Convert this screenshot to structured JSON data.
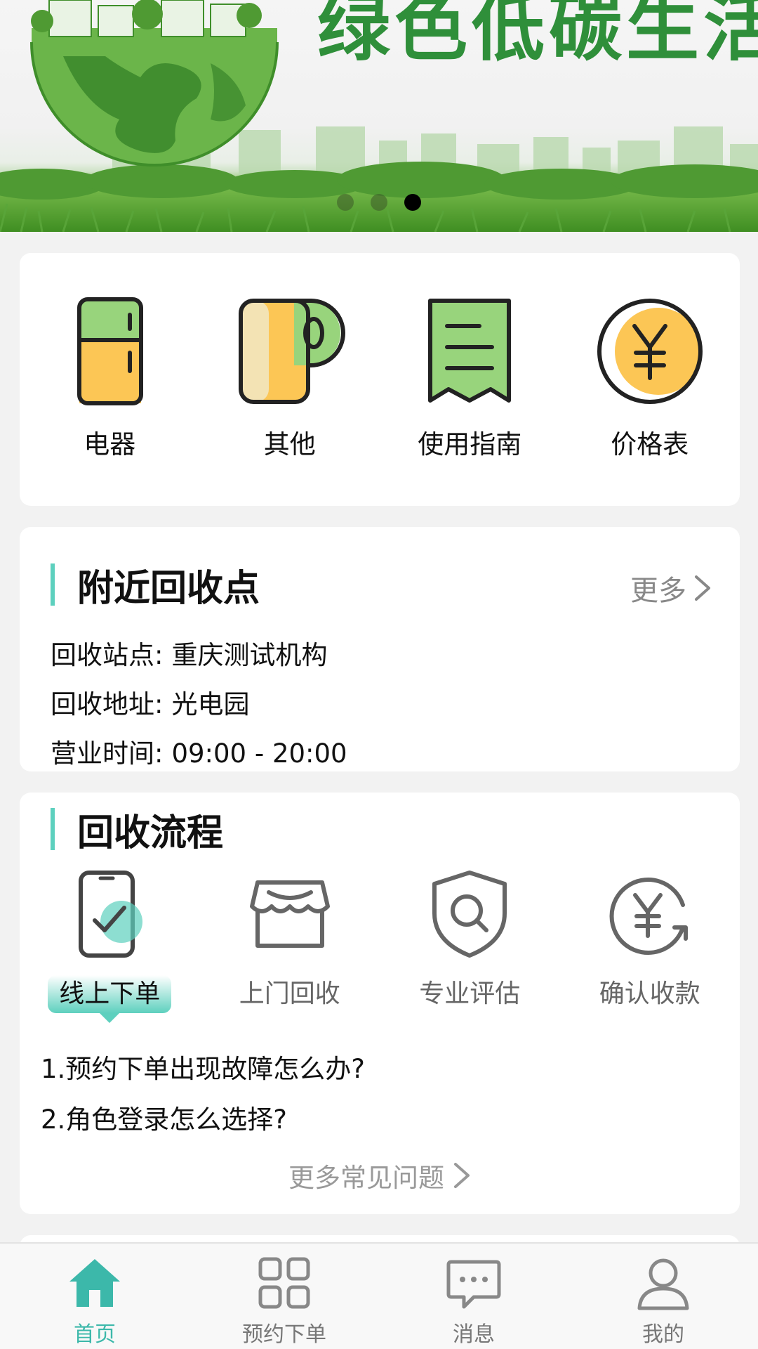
{
  "banner": {
    "title": "绿色低碳生活",
    "slide_count": 3,
    "active_slide": 3
  },
  "categories": [
    {
      "label": "电器",
      "icon": "fridge-icon"
    },
    {
      "label": "其他",
      "icon": "paper-roll-icon"
    },
    {
      "label": "使用指南",
      "icon": "guide-document-icon"
    },
    {
      "label": "价格表",
      "icon": "yuan-coin-icon"
    }
  ],
  "nearby": {
    "title": "附近回收点",
    "more_label": "更多",
    "station_label": "回收站点:",
    "station_value": "重庆测试机构",
    "address_label": "回收地址:",
    "address_value": "光电园",
    "hours_label": "营业时间:",
    "hours_value": "09:00 - 20:00"
  },
  "process": {
    "title": "回收流程",
    "steps": [
      {
        "label": "线上下单",
        "icon": "phone-check-icon",
        "active": true
      },
      {
        "label": "上门回收",
        "icon": "storefront-icon",
        "active": false
      },
      {
        "label": "专业评估",
        "icon": "shield-search-icon",
        "active": false
      },
      {
        "label": "确认收款",
        "icon": "yuan-refresh-icon",
        "active": false
      }
    ],
    "faq": [
      "1.预约下单出现故障怎么办?",
      "2.角色登录怎么选择?"
    ],
    "faq_more_label": "更多常见问题"
  },
  "tabbar": {
    "items": [
      {
        "label": "首页",
        "icon": "home-icon",
        "active": true
      },
      {
        "label": "预约下单",
        "icon": "grid-icon",
        "active": false
      },
      {
        "label": "消息",
        "icon": "message-icon",
        "active": false
      },
      {
        "label": "我的",
        "icon": "user-icon",
        "active": false
      }
    ]
  },
  "colors": {
    "accent": "#5dd0be",
    "tab_active": "#3cb8aa",
    "banner_green": "#2f8f3a",
    "icon_green": "#98d47c",
    "icon_yellow": "#fcc655"
  }
}
